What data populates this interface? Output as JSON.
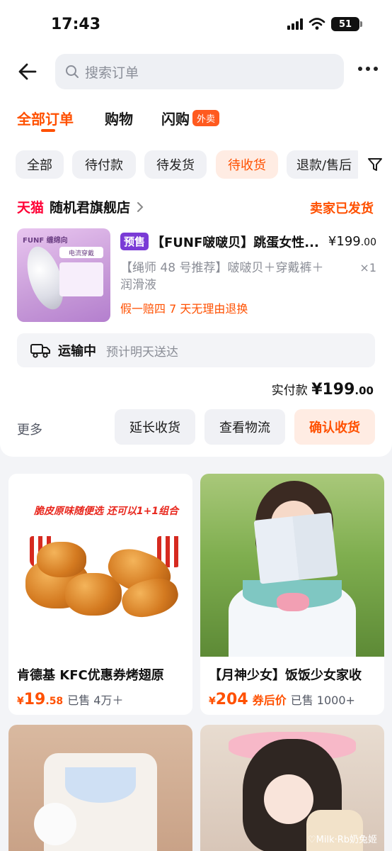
{
  "status_bar": {
    "time": "17:43",
    "battery": "51"
  },
  "header": {
    "search_placeholder": "搜索订单"
  },
  "main_tabs": [
    {
      "label": "全部订单",
      "active": true
    },
    {
      "label": "购物",
      "active": false
    },
    {
      "label": "闪购",
      "badge": "外卖",
      "active": false
    }
  ],
  "filter_chips": [
    {
      "label": "全部",
      "active": false
    },
    {
      "label": "待付款",
      "active": false
    },
    {
      "label": "待发货",
      "active": false
    },
    {
      "label": "待收货",
      "active": true
    },
    {
      "label": "退款/售后",
      "active": false
    }
  ],
  "order": {
    "platform": "天猫",
    "shop_name": "随机君旗舰店",
    "status": "卖家已发货",
    "product_image_brand": "FUNF 缠绵向",
    "product_image_tag": "电流穿戴",
    "presale_tag": "预售",
    "product_title": "【FUNF啵啵贝】跳蛋女性...",
    "price_main": "¥199",
    "price_decimal": ".00",
    "sku": "【绳师 48 号推荐】啵啵贝＋穿戴裤＋润滑液",
    "quantity": "×1",
    "guarantee": "假一赔四  7 天无理由退换",
    "shipping_status": "运输中",
    "shipping_eta": "预计明天送达",
    "paid_label": "实付款",
    "paid_main": "¥199",
    "paid_decimal": ".00",
    "more": "更多",
    "actions": [
      "延长收货",
      "查看物流",
      "确认收货"
    ]
  },
  "recommendations": [
    {
      "title": "肯德基 KFC优惠券烤翅原",
      "price_symbol": "¥",
      "price_main": "19",
      "price_decimal": ".58",
      "price_suffix": "",
      "sold": "已售 4万＋",
      "banner": "脆皮原味随便选 还可以1+1组合"
    },
    {
      "title": "【月神少女】饭饭少女家收",
      "price_symbol": "¥",
      "price_main": "204",
      "price_decimal": "",
      "price_suffix": "券后价",
      "sold": "已售 1000+"
    },
    {
      "title": "",
      "price_main": "",
      "sold": ""
    },
    {
      "title": "",
      "price_main": "",
      "sold": "",
      "watermark": "♡Milk·Rb奶兔姬"
    }
  ],
  "colors": {
    "accent": "#ff5000",
    "tmall_red": "#ff0036",
    "presale_purple": "#7a3bd6"
  }
}
